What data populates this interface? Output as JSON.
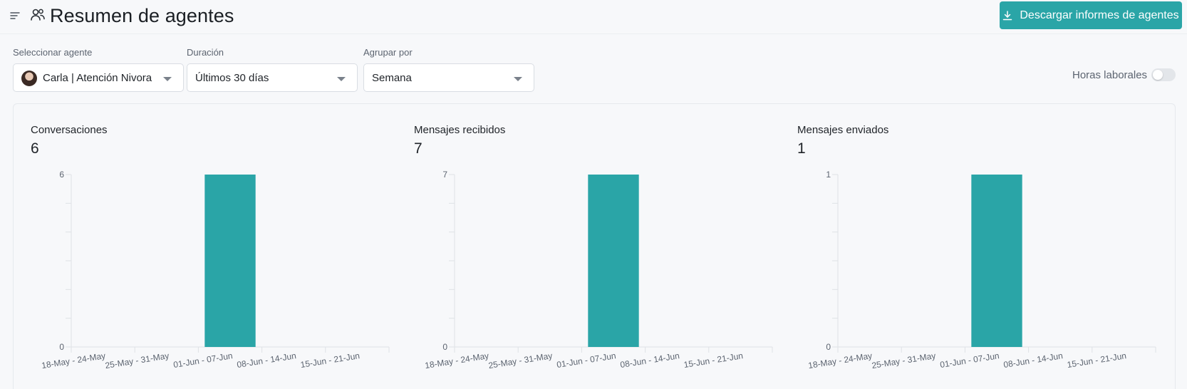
{
  "header": {
    "title": "Resumen de agentes",
    "download_label": "Descargar informes de agentes"
  },
  "filters": {
    "agent": {
      "label": "Seleccionar agente",
      "value": "Carla | Atención Nivora"
    },
    "duration": {
      "label": "Duración",
      "value": "Últimos 30 días"
    },
    "group_by": {
      "label": "Agrupar por",
      "value": "Semana"
    },
    "business_hours": {
      "label": "Horas laborales",
      "enabled": false
    }
  },
  "metrics": [
    {
      "title": "Conversaciones",
      "value": "6"
    },
    {
      "title": "Mensajes recibidos",
      "value": "7"
    },
    {
      "title": "Mensajes enviados",
      "value": "1"
    }
  ],
  "colors": {
    "accent": "#2aa5a7",
    "bar": "#2aa5a7"
  },
  "chart_data": [
    {
      "type": "bar",
      "categories": [
        "18-May - 24-May",
        "25-May - 31-May",
        "01-Jun - 07-Jun",
        "08-Jun - 14-Jun",
        "15-Jun - 21-Jun"
      ],
      "values": [
        0,
        0,
        6,
        0,
        0
      ],
      "ylim": [
        0,
        6
      ],
      "yticks": [
        "0",
        "6"
      ]
    },
    {
      "type": "bar",
      "categories": [
        "18-May - 24-May",
        "25-May - 31-May",
        "01-Jun - 07-Jun",
        "08-Jun - 14-Jun",
        "15-Jun - 21-Jun"
      ],
      "values": [
        0,
        0,
        7,
        0,
        0
      ],
      "ylim": [
        0,
        7
      ],
      "yticks": [
        "0",
        "7"
      ]
    },
    {
      "type": "bar",
      "categories": [
        "18-May - 24-May",
        "25-May - 31-May",
        "01-Jun - 07-Jun",
        "08-Jun - 14-Jun",
        "15-Jun - 21-Jun"
      ],
      "values": [
        0,
        0,
        1,
        0,
        0
      ],
      "ylim": [
        0,
        1
      ],
      "yticks": [
        "0",
        "1"
      ]
    }
  ]
}
